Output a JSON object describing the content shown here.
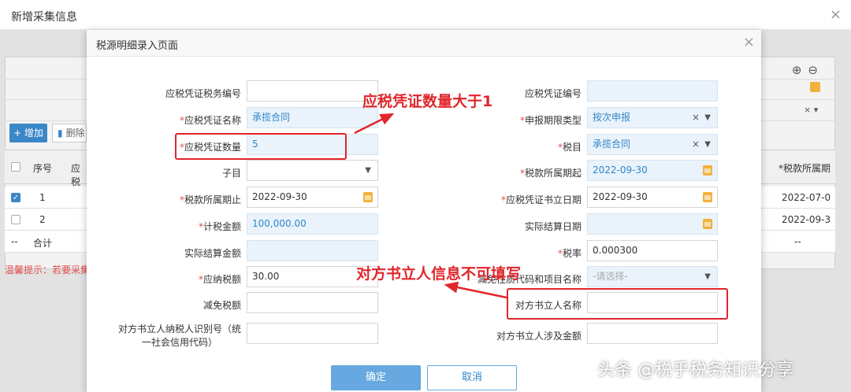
{
  "outer": {
    "title": "新增采集信息",
    "close_icon": "×"
  },
  "background": {
    "add_label": "+ 增加",
    "delete_label": "删除",
    "columns": {
      "check": "",
      "seq": "序号",
      "name_partial": "应税",
      "period_partial": "*税款所属期"
    },
    "rows": [
      {
        "seq": "1",
        "checked": true,
        "period": "2022-07-0"
      },
      {
        "seq": "2",
        "checked": false,
        "period": "2022-09-3"
      }
    ],
    "total_row": {
      "seq": "--",
      "label": "合计",
      "period": "--"
    },
    "hint": "温馨提示：若要采集",
    "zoom_in": "⊕",
    "zoom_out": "⊖"
  },
  "modal": {
    "title": "税源明细录入页面",
    "close_icon": "×",
    "left_fields": [
      {
        "label": "应税凭证税务编号",
        "required": false,
        "value": ""
      },
      {
        "label": "应税凭证名称",
        "required": true,
        "value": "承揽合同"
      },
      {
        "label": "应税凭证数量",
        "required": true,
        "value": "5"
      },
      {
        "label": "子目",
        "required": false,
        "value": ""
      },
      {
        "label": "税款所属期止",
        "required": true,
        "value": "2022-09-30"
      },
      {
        "label": "计税金额",
        "required": true,
        "value": "100,000.00"
      },
      {
        "label": "实际结算金额",
        "required": false,
        "value": ""
      },
      {
        "label": "应纳税额",
        "required": true,
        "value": "30.00"
      },
      {
        "label": "减免税额",
        "required": false,
        "value": ""
      },
      {
        "label_line1": "对方书立人纳税人识别号（统",
        "label_line2": "一社会信用代码）",
        "required": false,
        "value": ""
      }
    ],
    "right_fields": [
      {
        "label": "应税凭证编号",
        "required": false,
        "value": ""
      },
      {
        "label": "申报期限类型",
        "required": true,
        "value": "按次申报"
      },
      {
        "label": "税目",
        "required": true,
        "value": "承揽合同"
      },
      {
        "label": "税款所属期起",
        "required": true,
        "value": "2022-09-30"
      },
      {
        "label": "应税凭证书立日期",
        "required": true,
        "value": "2022-09-30"
      },
      {
        "label": "实际结算日期",
        "required": false,
        "value": ""
      },
      {
        "label": "税率",
        "required": true,
        "value": "0.000300"
      },
      {
        "label": "减免性质代码和项目名称",
        "required": false,
        "value": "-请选择-"
      },
      {
        "label": "对方书立人名称",
        "required": false,
        "value": ""
      },
      {
        "label": "对方书立人涉及金额",
        "required": false,
        "value": ""
      }
    ],
    "ok_label": "确定",
    "cancel_label": "取消"
  },
  "annotations": {
    "qty_note": "应税凭证数量大于1",
    "party_note": "对方书立人信息不可填写",
    "accent_color": "#e0262b"
  },
  "watermark": "头条 @税乎税务知识分享"
}
